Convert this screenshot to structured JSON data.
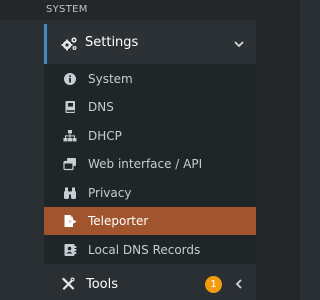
{
  "section": {
    "title": "SYSTEM"
  },
  "settings": {
    "label": "Settings",
    "icon": "cogs-icon",
    "expanded": true
  },
  "submenu": {
    "items": [
      {
        "label": "System",
        "icon": "info-circle-icon",
        "active": false
      },
      {
        "label": "DNS",
        "icon": "book-icon",
        "active": false
      },
      {
        "label": "DHCP",
        "icon": "sitemap-icon",
        "active": false
      },
      {
        "label": "Web interface / API",
        "icon": "window-restore-icon",
        "active": false
      },
      {
        "label": "Privacy",
        "icon": "binoculars-icon",
        "active": false
      },
      {
        "label": "Teleporter",
        "icon": "file-export-icon",
        "active": true
      },
      {
        "label": "Local DNS Records",
        "icon": "address-book-icon",
        "active": false
      }
    ]
  },
  "tools": {
    "label": "Tools",
    "icon": "tools-icon",
    "badge": "1",
    "badge_color": "#f39c12"
  },
  "colors": {
    "active_bg": "#a0552e",
    "accent": "#3c8dbc"
  }
}
